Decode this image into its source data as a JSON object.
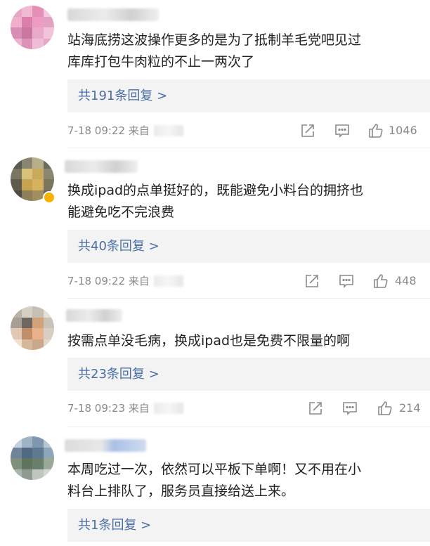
{
  "comments": [
    {
      "text_line1": "站海底捞这波操作更多的是为了抵制羊毛党吧见过",
      "text_line2": "库库打包牛肉粒的不止一两次了",
      "reply_label": "共191条回复 >",
      "time": "7-18 09:22",
      "source_prefix": "来自",
      "likes": "1046"
    },
    {
      "text_line1": "换成ipad的点单挺好的，既能避免小料台的拥挤也",
      "text_line2": "能避免吃不完浪费",
      "reply_label": "共40条回复 >",
      "time": "7-18 09:22",
      "source_prefix": "来自",
      "likes": "448"
    },
    {
      "text_line1": "按需点单没毛病，换成ipad也是免费不限量的啊",
      "reply_label": "共23条回复 >",
      "time": "7-18 09:23",
      "source_prefix": "来自",
      "likes": "214"
    },
    {
      "text_line1": "本周吃过一次，依然可以平板下单啊！又不用在小",
      "text_line2": "料台上排队了，服务员直接给送上来。",
      "reply_label": "共1条回复 >"
    }
  ],
  "icons": {
    "share": "share-icon",
    "comment": "comment-icon",
    "like": "thumbs-up-icon"
  },
  "colors": {
    "reply_link": "#4a6fa5",
    "reply_bg": "#f3f3f3",
    "meta_text": "#8a8a8a"
  }
}
